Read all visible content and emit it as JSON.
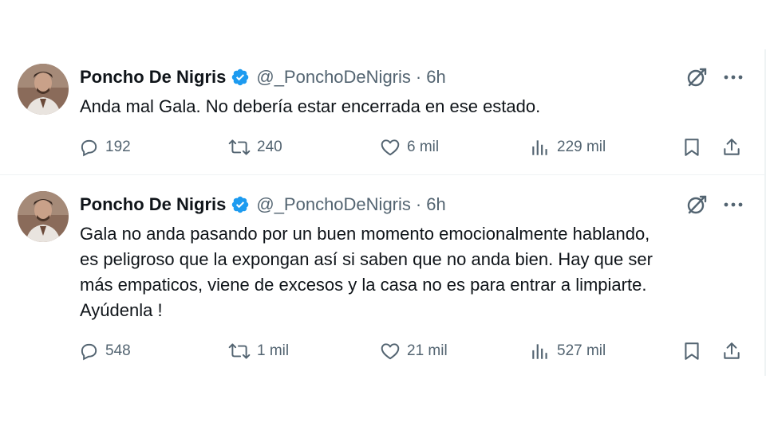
{
  "colors": {
    "text_primary": "#0f1419",
    "text_secondary": "#536471",
    "verified_blue": "#1d9bf0",
    "divider": "#eff3f4",
    "background": "#ffffff"
  },
  "tweets": [
    {
      "author": {
        "name": "Poncho De Nigris",
        "handle": "@_PonchoDeNigris",
        "verified_icon": "verified-badge-icon",
        "avatar": "avatar-photo"
      },
      "separator": "·",
      "time": "6h",
      "text_lines": [
        "Anda mal Gala. No debería estar encerrada en ese estado."
      ],
      "stats": {
        "replies": "192",
        "retweets": "240",
        "likes": "6 mil",
        "views": "229 mil"
      }
    },
    {
      "author": {
        "name": "Poncho De Nigris",
        "handle": "@_PonchoDeNigris",
        "verified_icon": "verified-badge-icon",
        "avatar": "avatar-photo"
      },
      "separator": "·",
      "time": "6h",
      "text_lines": [
        "Gala no anda pasando por un buen momento emocionalmente hablando,",
        "es peligroso que la expongan así si saben que no anda bien.  Hay que ser",
        "más empaticos, viene de excesos y la casa no es para entrar a limpiarte.",
        "Ayúdenla !"
      ],
      "stats": {
        "replies": "548",
        "retweets": "1 mil",
        "likes": "21 mil",
        "views": "527 mil"
      }
    }
  ],
  "icons": {
    "grok": "grok-icon",
    "more": "more-options-icon",
    "reply": "reply-icon",
    "retweet": "retweet-icon",
    "like": "heart-icon",
    "views": "views-chart-icon",
    "bookmark": "bookmark-icon",
    "share": "share-icon"
  }
}
